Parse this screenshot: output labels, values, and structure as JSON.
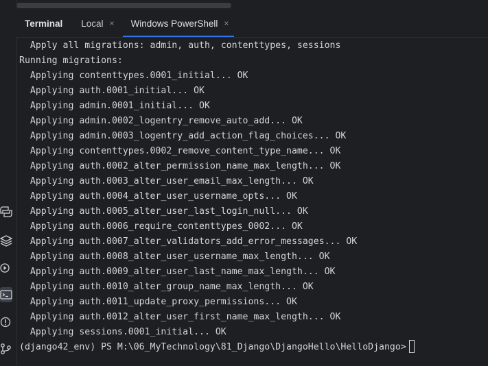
{
  "tabs": {
    "title": "Terminal",
    "items": [
      {
        "label": "Local",
        "close": "×",
        "active": false
      },
      {
        "label": "Windows PowerShell",
        "close": "×",
        "active": true
      }
    ]
  },
  "left_toolbar": {
    "icons": [
      "python-console-icon",
      "layers-icon",
      "services-icon",
      "terminal-icon",
      "problems-icon",
      "git-icon"
    ]
  },
  "terminal": {
    "lines": [
      "  Apply all migrations: admin, auth, contenttypes, sessions",
      "Running migrations:",
      "  Applying contenttypes.0001_initial... OK",
      "  Applying auth.0001_initial... OK",
      "  Applying admin.0001_initial... OK",
      "  Applying admin.0002_logentry_remove_auto_add... OK",
      "  Applying admin.0003_logentry_add_action_flag_choices... OK",
      "  Applying contenttypes.0002_remove_content_type_name... OK",
      "  Applying auth.0002_alter_permission_name_max_length... OK",
      "  Applying auth.0003_alter_user_email_max_length... OK",
      "  Applying auth.0004_alter_user_username_opts... OK",
      "  Applying auth.0005_alter_user_last_login_null... OK",
      "  Applying auth.0006_require_contenttypes_0002... OK",
      "  Applying auth.0007_alter_validators_add_error_messages... OK",
      "  Applying auth.0008_alter_user_username_max_length... OK",
      "  Applying auth.0009_alter_user_last_name_max_length... OK",
      "  Applying auth.0010_alter_group_name_max_length... OK",
      "  Applying auth.0011_update_proxy_permissions... OK",
      "  Applying auth.0012_alter_user_first_name_max_length... OK",
      "  Applying sessions.0001_initial... OK"
    ],
    "prompt": "(django42_env) PS M:\\06_MyTechnology\\81_Django\\DjangoHello\\HelloDjango>"
  }
}
